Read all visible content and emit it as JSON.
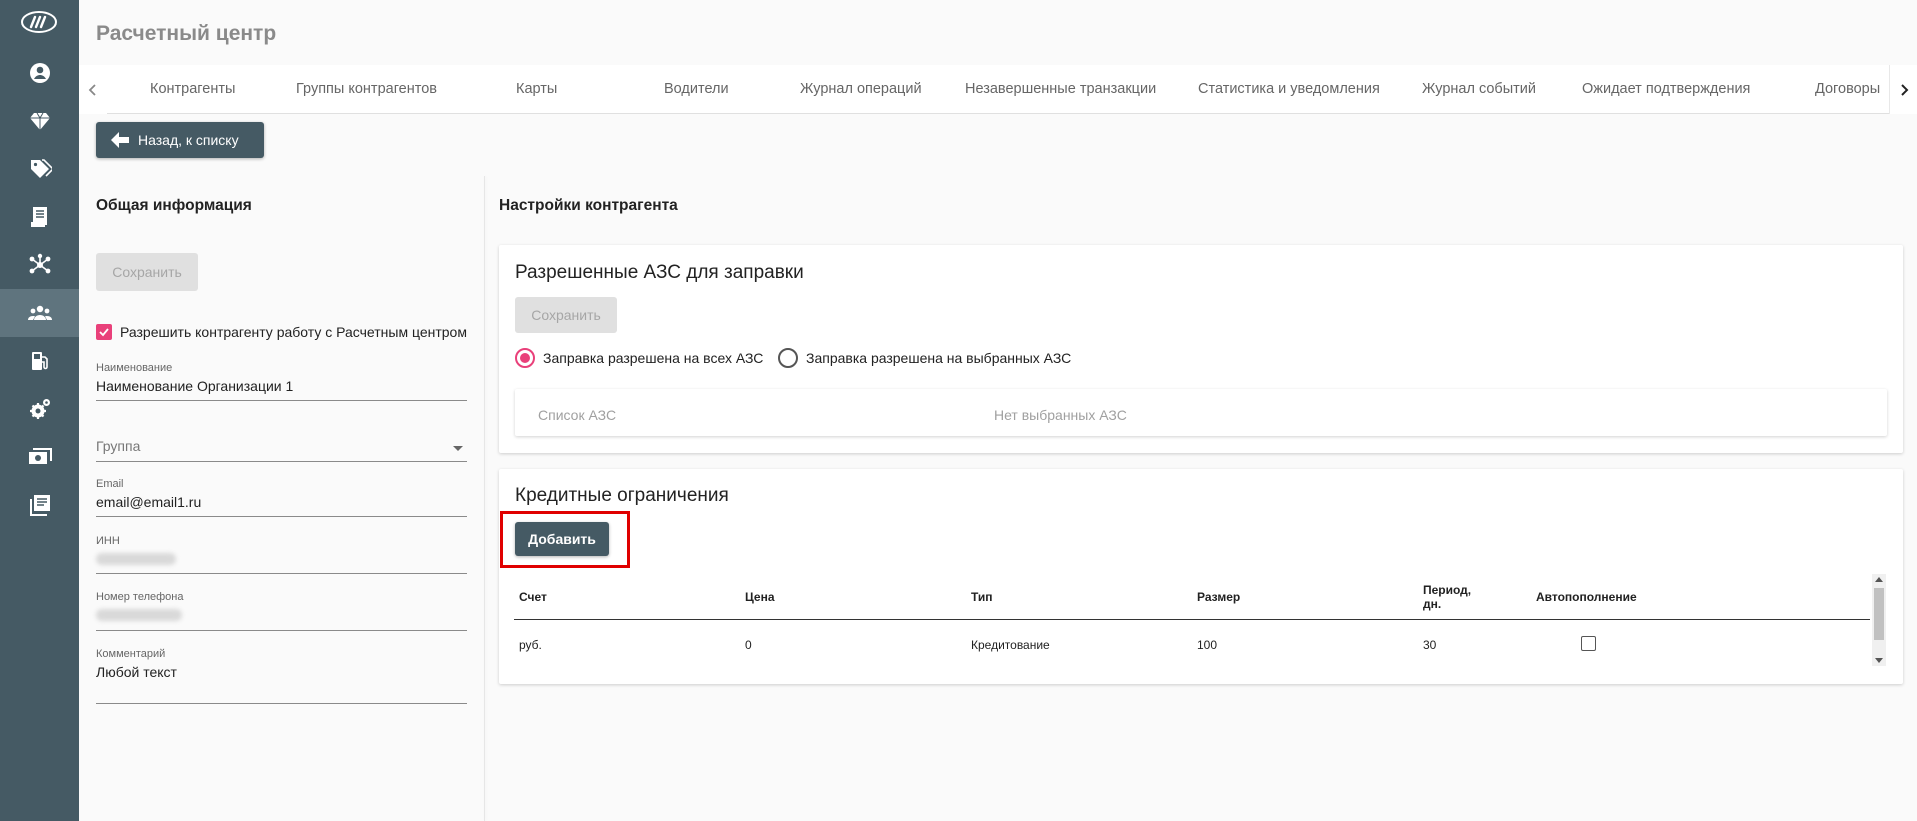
{
  "app": {
    "title": "Расчетный центр"
  },
  "tabs": [
    {
      "label": "Контрагенты"
    },
    {
      "label": "Группы контрагентов"
    },
    {
      "label": "Карты"
    },
    {
      "label": "Водители"
    },
    {
      "label": "Журнал операций"
    },
    {
      "label": "Незавершенные транзакции"
    },
    {
      "label": "Статистика и уведомления"
    },
    {
      "label": "Журнал событий"
    },
    {
      "label": "Ожидает подтверждения"
    },
    {
      "label": "Договоры"
    }
  ],
  "sidebar": {
    "items": [
      {
        "icon": "user-icon"
      },
      {
        "icon": "diamond-icon"
      },
      {
        "icon": "tags-icon"
      },
      {
        "icon": "receipt-icon"
      },
      {
        "icon": "network-icon"
      },
      {
        "icon": "group-icon",
        "active": true
      },
      {
        "icon": "fuel-icon"
      },
      {
        "icon": "settings-gear-icon"
      },
      {
        "icon": "money-icon"
      },
      {
        "icon": "library-icon"
      }
    ]
  },
  "back_button": {
    "label": "Назад, к списку"
  },
  "general": {
    "title": "Общая информация",
    "save_label": "Сохранить",
    "allow_checkbox_label": "Разрешить контрагенту работу с Расчетным центром",
    "name": {
      "label": "Наименование",
      "value": "Наименование Организации 1"
    },
    "group": {
      "placeholder": "Группа"
    },
    "email": {
      "label": "Email",
      "value": "email@email1.ru"
    },
    "inn": {
      "label": "ИНН"
    },
    "phone": {
      "label": "Номер телефона"
    },
    "comment": {
      "label": "Комментарий",
      "value": "Любой текст"
    }
  },
  "settings": {
    "title": "Настройки контрагента",
    "allowed_azs": {
      "title": "Разрешенные АЗС для заправки",
      "save_label": "Сохранить",
      "radio_all": "Заправка разрешена на всех АЗС",
      "radio_selected": "Заправка разрешена на выбранных АЗС",
      "list_label": "Список АЗС",
      "none_selected_label": "Нет выбранных АЗС"
    },
    "credit": {
      "title": "Кредитные ограничения",
      "add_label": "Добавить",
      "columns": {
        "account": "Счет",
        "price": "Цена",
        "type": "Тип",
        "size": "Размер",
        "period_line1": "Период,",
        "period_line2": "дн.",
        "autofill": "Автопополнение"
      },
      "rows": [
        {
          "account": "руб.",
          "price": "0",
          "type": "Кредитование",
          "size": "100",
          "period": "30",
          "autofill": false
        }
      ]
    }
  },
  "colors": {
    "sidebar": "#455a64",
    "accent": "#e9407a",
    "highlight": "#e00000"
  }
}
